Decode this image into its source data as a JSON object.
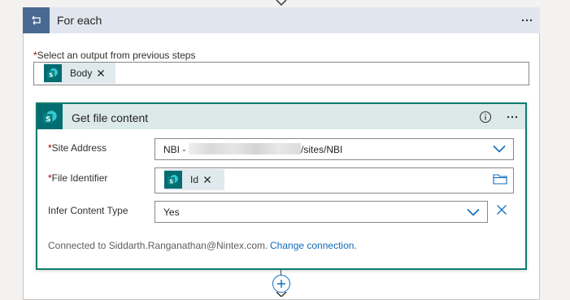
{
  "foreach": {
    "title": "For each",
    "select_label": "Select an output from previous steps",
    "token": "Body"
  },
  "action": {
    "title": "Get file content",
    "fields": {
      "site_address": {
        "label": "Site Address",
        "value_prefix": "NBI - ",
        "value_suffix": "/sites/NBI"
      },
      "file_identifier": {
        "label": "File Identifier",
        "token": "Id"
      },
      "infer_content_type": {
        "label": "Infer Content Type",
        "value": "Yes"
      }
    },
    "connection_text": "Connected to Siddarth.Ranganathan@Nintex.com.",
    "change_connection": "Change connection."
  },
  "required_marker": "*",
  "colors": {
    "foreach_accent": "#486991",
    "sharepoint": "#036c70",
    "action_border": "#0f7b6c",
    "link": "#0f6cbd"
  },
  "icons": [
    "loop-icon",
    "more-options-icon",
    "sharepoint-icon",
    "remove-token-icon",
    "info-icon",
    "chevron-down-icon",
    "file-picker-icon",
    "clear-icon",
    "add-step-icon"
  ]
}
